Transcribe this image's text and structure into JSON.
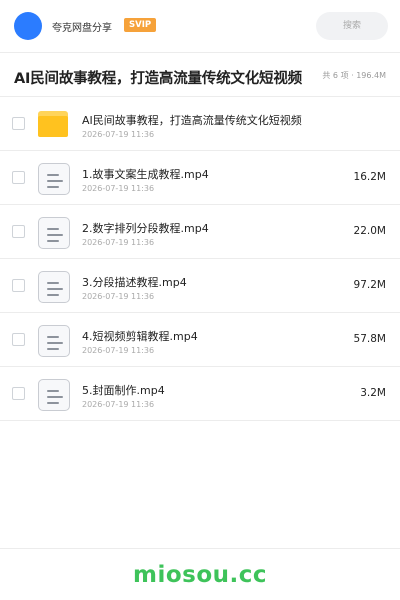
{
  "header": {
    "user_name": "夸克网盘分享",
    "badge": "SVIP",
    "search_placeholder": "搜索"
  },
  "share": {
    "title": "AI民间故事教程，打造高流量传统文化短视频",
    "summary": "共 6 项 · 196.4M"
  },
  "files": [
    {
      "type": "folder",
      "name": "AI民间故事教程，打造高流量传统文化短视频",
      "date": "2026-07-19 11:36",
      "size": ""
    },
    {
      "type": "file",
      "name": "1.故事文案生成教程.mp4",
      "date": "2026-07-19 11:36",
      "size": "16.2M"
    },
    {
      "type": "file",
      "name": "2.数字排列分段教程.mp4",
      "date": "2026-07-19 11:36",
      "size": "22.0M"
    },
    {
      "type": "file",
      "name": "3.分段描述教程.mp4",
      "date": "2026-07-19 11:36",
      "size": "97.2M"
    },
    {
      "type": "file",
      "name": "4.短视频剪辑教程.mp4",
      "date": "2026-07-19 11:36",
      "size": "57.8M"
    },
    {
      "type": "file",
      "name": "5.封面制作.mp4",
      "date": "2026-07-19 11:36",
      "size": "3.2M"
    }
  ],
  "watermark": "miosou.cc",
  "colors": {
    "avatar": "#2b7cff",
    "badge": "#f6a23a",
    "folder": "#ffc21f",
    "watermark": "#3ec35a"
  }
}
